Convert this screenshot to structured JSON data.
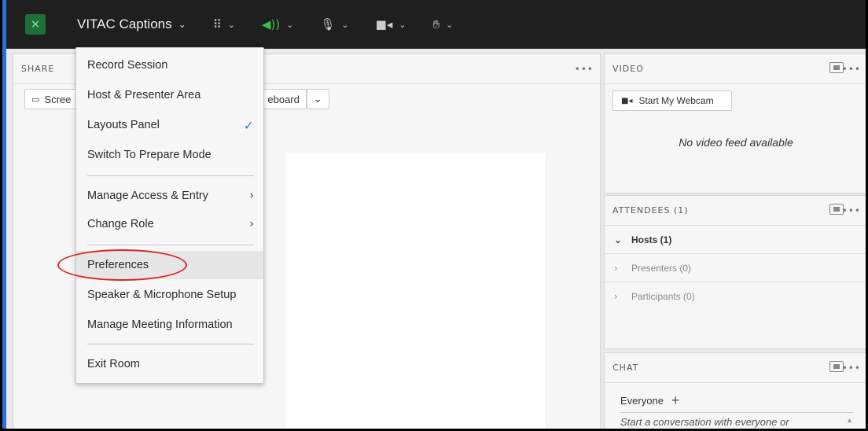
{
  "topbar": {
    "logo_icon": "connect-logo",
    "room_name": "VITAC Captions",
    "tools": [
      {
        "name": "apps-grid",
        "glyph": "⋮⋮⋮"
      },
      {
        "name": "speaker",
        "glyph": "🔊"
      },
      {
        "name": "microphone",
        "glyph": "🎙"
      },
      {
        "name": "camera",
        "glyph": "📹"
      },
      {
        "name": "raise-hand",
        "glyph": "✋"
      }
    ],
    "chevron": "⌄",
    "accent": "#32c24d"
  },
  "share_pod": {
    "title": "SHARE",
    "more": "•••",
    "screen_button": "Scree",
    "whiteboard_button": "eboard",
    "dropdown": "⌄"
  },
  "video_pod": {
    "title": "VIDEO",
    "more": "•••",
    "webcam_button": "Start My Webcam",
    "empty_text": "No video feed available"
  },
  "attendees_pod": {
    "title": "ATTENDEES (1)",
    "more": "•••",
    "groups": [
      {
        "label": "Hosts (1)",
        "arrow": "⌄"
      },
      {
        "label": "Presenters (0)",
        "arrow": "›"
      },
      {
        "label": "Participants (0)",
        "arrow": "›"
      }
    ]
  },
  "chat_pod": {
    "title": "CHAT",
    "more": "•••",
    "tab": "Everyone",
    "add": "+",
    "placeholder": "Start a conversation with everyone or",
    "scroll": "▲"
  },
  "menu": {
    "items": [
      {
        "label": "Record Session"
      },
      {
        "label": "Host & Presenter Area"
      },
      {
        "label": "Layouts Panel",
        "mark": "✓"
      },
      {
        "label": "Switch To Prepare Mode"
      },
      {
        "label": "Manage Access & Entry",
        "mark": "›"
      },
      {
        "label": "Change Role",
        "mark": "›"
      },
      {
        "label": "Preferences"
      },
      {
        "label": "Speaker & Microphone Setup"
      },
      {
        "label": "Manage Meeting Information"
      },
      {
        "label": "Exit Room"
      }
    ],
    "highlight_color": "#d42a2a"
  }
}
